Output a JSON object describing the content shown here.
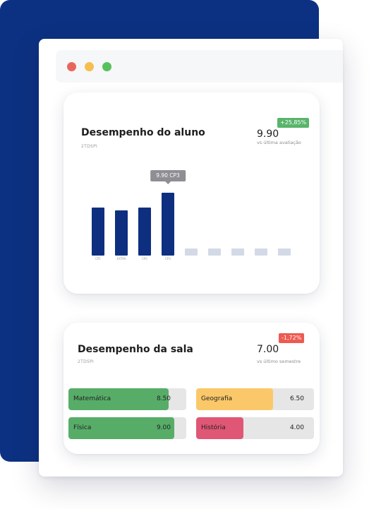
{
  "window": {
    "dots": [
      "#e8675c",
      "#f5bf4f",
      "#58c15b"
    ]
  },
  "student_card": {
    "title": "Desempenho do aluno",
    "subtitle": "2TDSPI",
    "score": "9.90",
    "score_caption": "vs última avaliação",
    "change": "+25,85%",
    "change_color": "#58b46a",
    "tooltip": "9.90  CP3",
    "chart_data": {
      "type": "bar",
      "categories": [
        "CP1",
        "EXTRA",
        "CP2",
        "CP3",
        "",
        "",
        "",
        "",
        ""
      ],
      "values": [
        7.5,
        7.1,
        7.5,
        9.9,
        null,
        null,
        null,
        null,
        null
      ],
      "bar_color": "#0e2f80",
      "empty_color": "#d3d9e6",
      "title": "",
      "xlabel": "",
      "ylabel": ""
    }
  },
  "class_card": {
    "title": "Desempenho da sala",
    "subtitle": "2TDSPI",
    "score": "7.00",
    "score_caption": "vs último semestre",
    "change": "-1,72%",
    "change_color": "#ee5a52",
    "subjects": [
      {
        "name": "Matemática",
        "value": "8.50",
        "fraction": 0.85,
        "color": "#57ad68"
      },
      {
        "name": "Geografia",
        "value": "6.50",
        "fraction": 0.65,
        "color": "#fbc869"
      },
      {
        "name": "Física",
        "value": "9.00",
        "fraction": 0.9,
        "color": "#57ad68"
      },
      {
        "name": "História",
        "value": "4.00",
        "fraction": 0.4,
        "color": "#e05775"
      }
    ]
  }
}
